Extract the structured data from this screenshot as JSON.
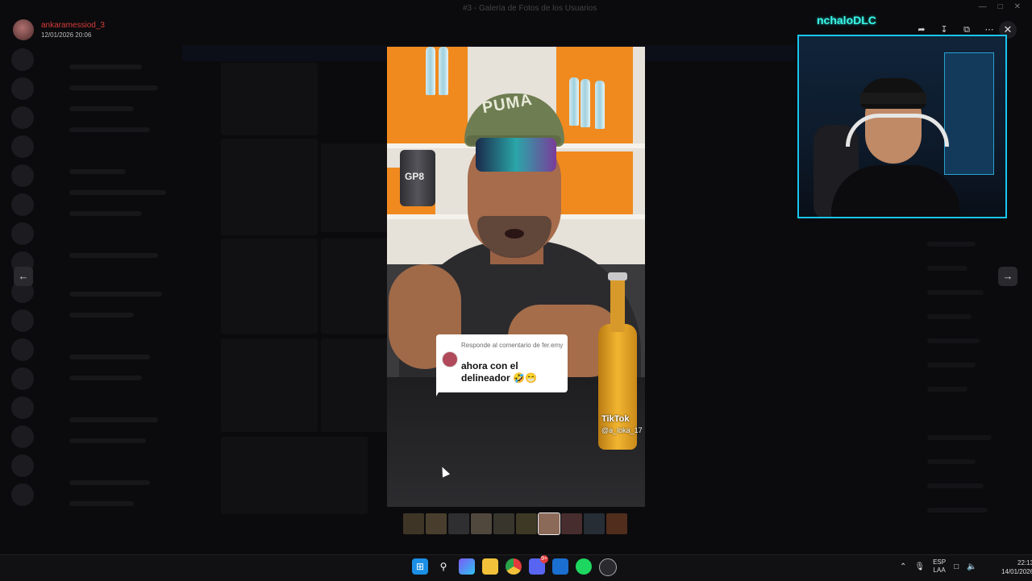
{
  "user": {
    "name": "ankaramessiod_3",
    "date": "12/01/2026 20:06"
  },
  "window": {
    "title": "#3 - Galería de Fotos de los Usuarios"
  },
  "viewer": {
    "close_icon": "close-icon",
    "prev_icon": "arrow-left-icon",
    "next_icon": "arrow-right-icon",
    "tools": [
      "share-icon",
      "download-icon",
      "open-external-icon",
      "more-icon"
    ]
  },
  "media": {
    "cap_text": "PUMA",
    "tub_label": "GP8",
    "comment": {
      "meta": "Responde al comentario de fer.emy",
      "text": "ahora con el delineador 🤣😁"
    },
    "watermark": "TikTok",
    "watermark_user": "@a_loka_17"
  },
  "webcam": {
    "streamer": "nchaloDLC"
  },
  "thumbnails": {
    "count": 10,
    "active_index": 6
  },
  "taskbar": {
    "apps": [
      "windows-start",
      "search",
      "copilot",
      "file-explorer",
      "chrome",
      "discord",
      "outlook",
      "spotify",
      "steam"
    ],
    "discord_badge": "9+",
    "lang_top": "ESP",
    "lang_bottom": "LAA",
    "time": "22:13",
    "date": "14/01/2026"
  },
  "colors": {
    "accent": "#19c6f0",
    "username": "#d83b3b",
    "streamer_name": "#3cf7e5"
  }
}
